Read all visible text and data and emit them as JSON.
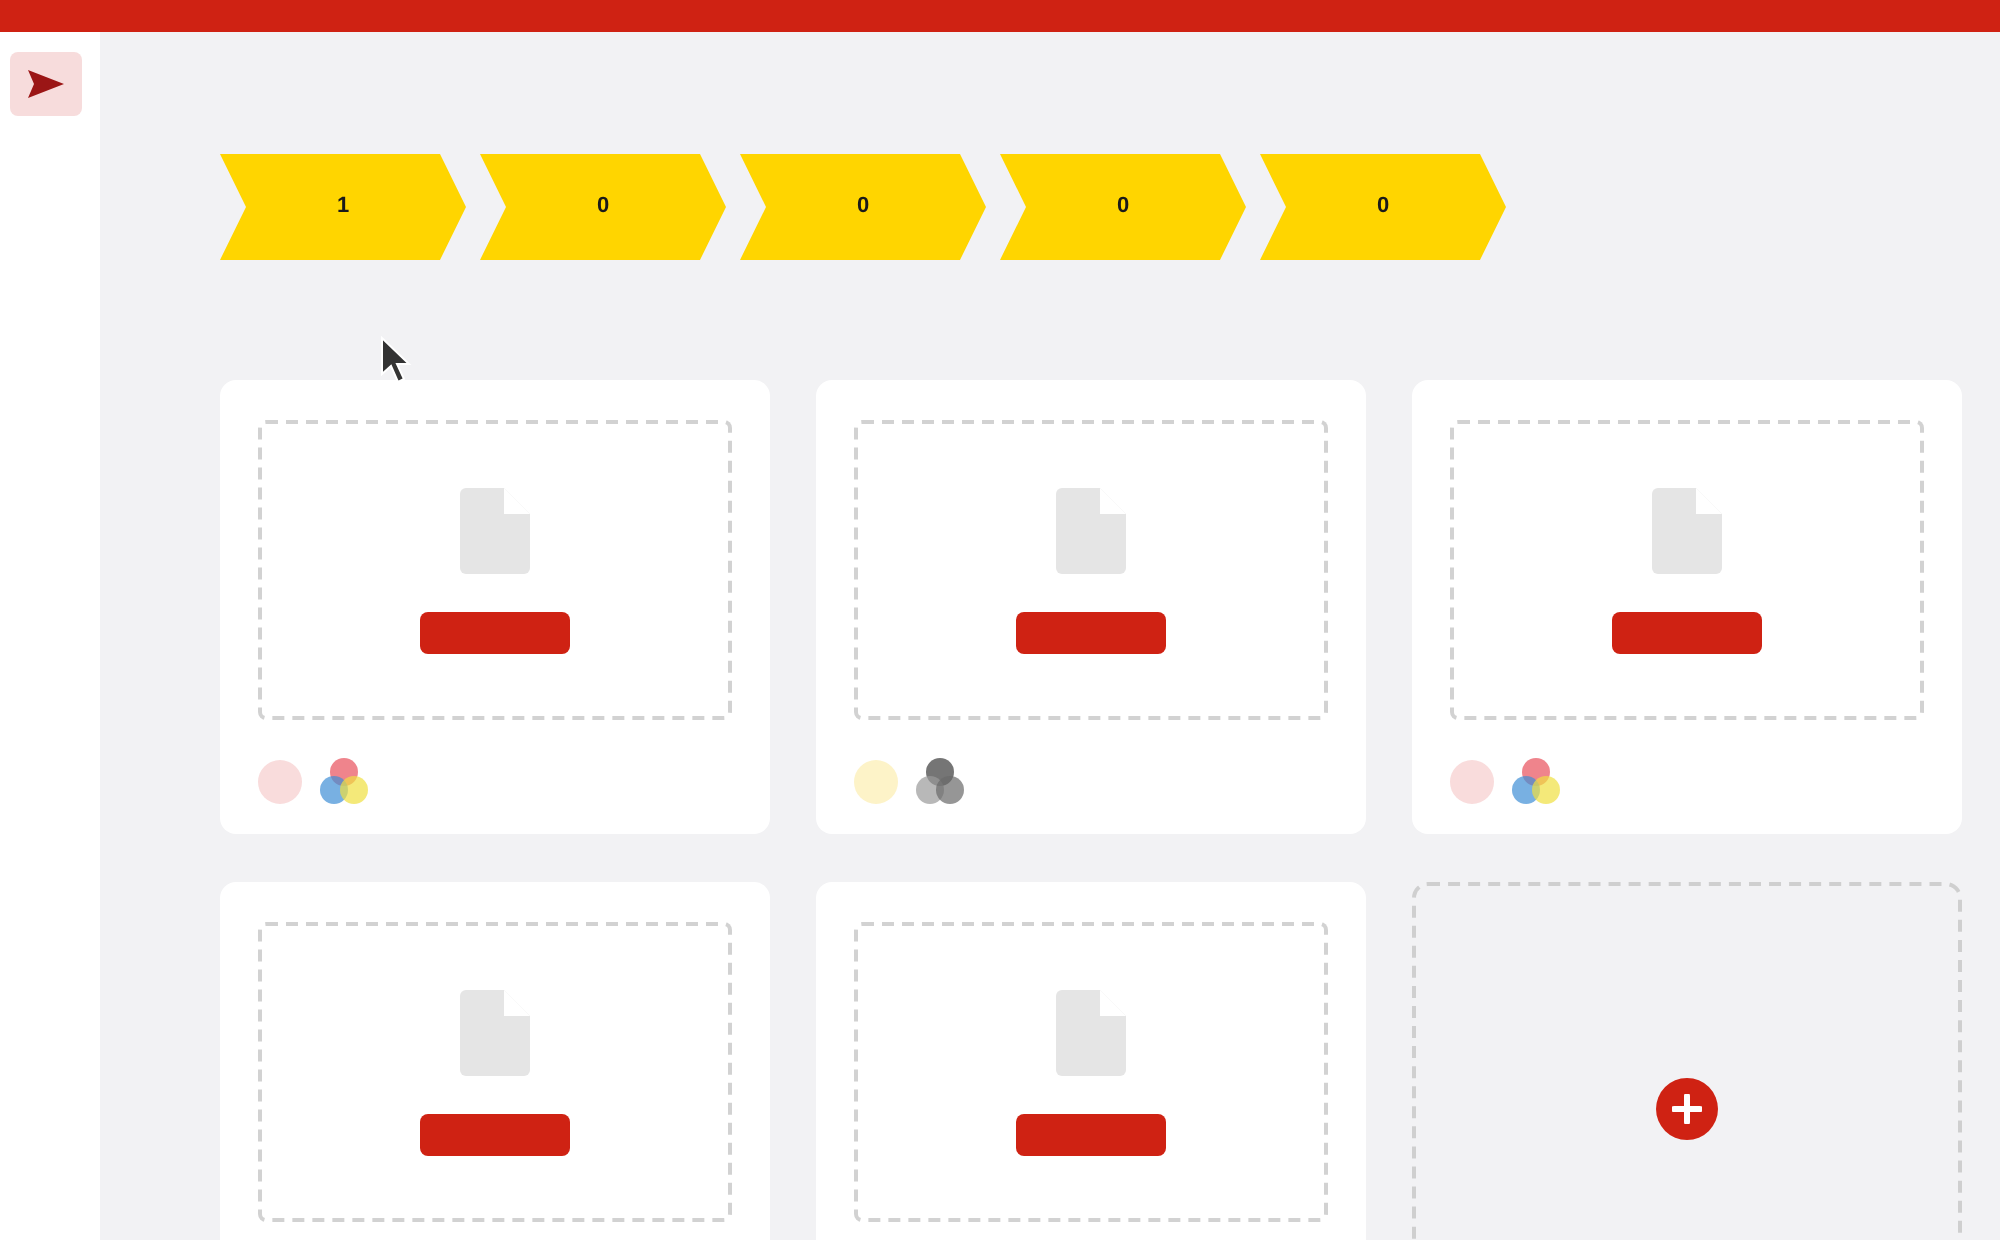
{
  "sidebar": {
    "items": [
      {
        "kind": "send",
        "selected": true
      }
    ]
  },
  "steps": [
    {
      "label": "1"
    },
    {
      "label": "0"
    },
    {
      "label": "0"
    },
    {
      "label": "0"
    },
    {
      "label": "0"
    }
  ],
  "cards": [
    {
      "kind": "document",
      "color": "#f9dcdc",
      "colored": true
    },
    {
      "kind": "document",
      "color": "#fdf3c8",
      "colored": false
    },
    {
      "kind": "document",
      "color": "#f9dcdc",
      "colored": true
    },
    {
      "kind": "document"
    },
    {
      "kind": "document"
    },
    {
      "kind": "add"
    }
  ]
}
